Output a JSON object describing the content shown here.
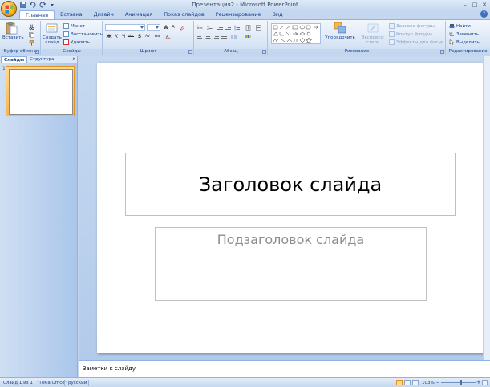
{
  "window": {
    "title": "Презентация2 - Microsoft PowerPoint",
    "minimize": "–",
    "maximize": "□",
    "close": "✕"
  },
  "tabs": [
    "Главная",
    "Вставка",
    "Дизайн",
    "Анимация",
    "Показ слайдов",
    "Рецензирование",
    "Вид"
  ],
  "ribbon": {
    "clipboard": {
      "label": "Буфер обмена",
      "paste": "Вставить"
    },
    "slides": {
      "label": "Слайды",
      "new_slide_line1": "Создать",
      "new_slide_line2": "слайд",
      "layout": "Макет",
      "reset": "Восстановить",
      "delete": "Удалить"
    },
    "font": {
      "label": "Шрифт",
      "font_name": "",
      "font_size": "",
      "bold": "Ж",
      "italic": "К",
      "underline": "Ч",
      "strike": "abc",
      "shadow": "S",
      "spacing": "AV",
      "case": "Aa",
      "grow": "A",
      "shrink": "A"
    },
    "paragraph": {
      "label": "Абзац"
    },
    "drawing": {
      "label": "Рисование",
      "arrange": "Упорядочить",
      "quick_styles": "Экспресс-стили",
      "shape_fill": "Заливка фигуры",
      "shape_outline": "Контур фигуры",
      "shape_effects": "Эффекты для фигур"
    },
    "editing": {
      "label": "Редактирование",
      "find": "Найти",
      "replace": "Заменить",
      "select": "Выделить"
    }
  },
  "left_panel": {
    "tab_slides": "Слайды",
    "tab_outline": "Структура",
    "close": "x",
    "slide_number": "1"
  },
  "slide": {
    "title": "Заголовок слайда",
    "subtitle": "Подзаголовок слайда"
  },
  "notes": {
    "placeholder": "Заметки к слайду"
  },
  "status": {
    "slide_info": "Слайд 1 из 1",
    "theme": "\"Тема Office\"",
    "language": "русский",
    "zoom": "103%",
    "zoom_minus": "–",
    "zoom_plus": "+"
  },
  "colors": {
    "ribbon_text": "#15428b",
    "selection": "#f8b450",
    "background": "#c4d7ee"
  }
}
